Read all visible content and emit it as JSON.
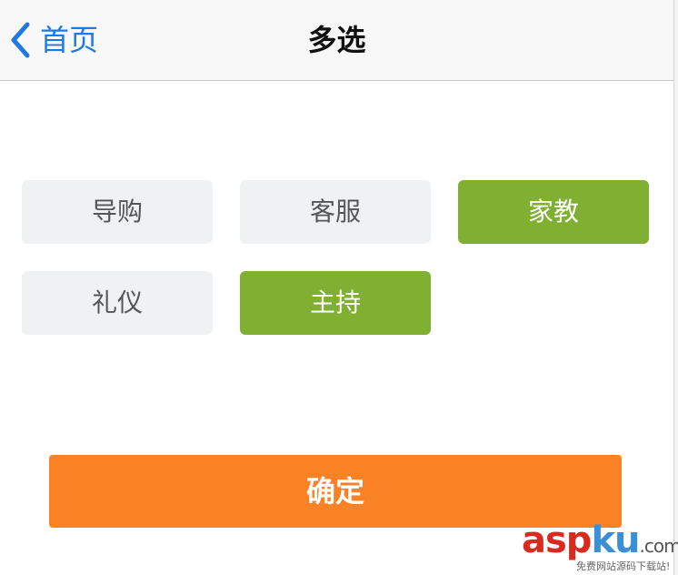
{
  "navbar": {
    "back_label": "首页",
    "title": "多选"
  },
  "options": [
    {
      "label": "导购",
      "selected": false
    },
    {
      "label": "客服",
      "selected": false
    },
    {
      "label": "家教",
      "selected": true
    },
    {
      "label": "礼仪",
      "selected": false
    },
    {
      "label": "主持",
      "selected": true
    }
  ],
  "confirm_label": "确定",
  "watermark": {
    "asp": "asp",
    "ku": "ku",
    "com": ".com",
    "subtitle": "免费网站源码下载站!"
  },
  "colors": {
    "accent_blue": "#1f7ae0",
    "selected_green": "#7fb032",
    "unselected_gray": "#f0f1f3",
    "confirm_orange": "#fb8125"
  },
  "icons": {
    "back": "chevron-left-icon"
  }
}
